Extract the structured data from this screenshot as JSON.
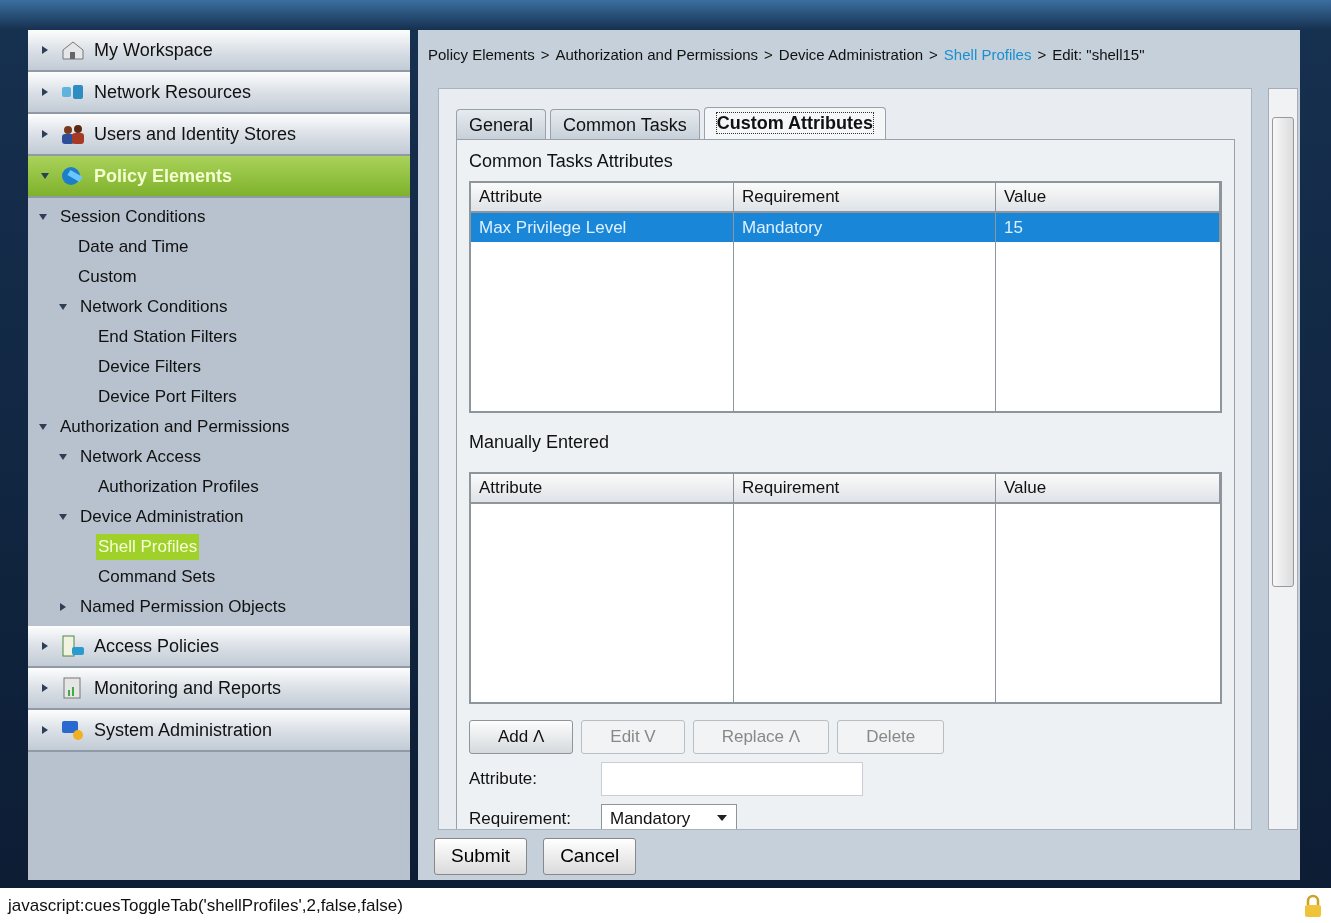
{
  "sidebar": {
    "sections": [
      {
        "label": "My Workspace",
        "expanded": false,
        "selected": false
      },
      {
        "label": "Network Resources",
        "expanded": false,
        "selected": false
      },
      {
        "label": "Users and Identity Stores",
        "expanded": false,
        "selected": false
      },
      {
        "label": "Policy Elements",
        "expanded": true,
        "selected": true,
        "children": [
          {
            "label": "Session Conditions",
            "expanded": true,
            "selected": false,
            "children": [
              {
                "label": "Date and Time",
                "selected": false
              },
              {
                "label": "Custom",
                "selected": false
              },
              {
                "label": "Network Conditions",
                "expanded": true,
                "selected": false,
                "children": [
                  {
                    "label": "End Station Filters",
                    "selected": false
                  },
                  {
                    "label": "Device Filters",
                    "selected": false
                  },
                  {
                    "label": "Device Port Filters",
                    "selected": false
                  }
                ]
              }
            ]
          },
          {
            "label": "Authorization and Permissions",
            "expanded": true,
            "selected": false,
            "children": [
              {
                "label": "Network Access",
                "expanded": true,
                "selected": false,
                "children": [
                  {
                    "label": "Authorization Profiles",
                    "selected": false
                  }
                ]
              },
              {
                "label": "Device Administration",
                "expanded": true,
                "selected": false,
                "children": [
                  {
                    "label": "Shell Profiles",
                    "selected": true
                  },
                  {
                    "label": "Command Sets",
                    "selected": false
                  }
                ]
              },
              {
                "label": "Named Permission Objects",
                "expanded": false,
                "selected": false
              }
            ]
          }
        ]
      },
      {
        "label": "Access Policies",
        "expanded": false,
        "selected": false
      },
      {
        "label": "Monitoring and Reports",
        "expanded": false,
        "selected": false
      },
      {
        "label": "System Administration",
        "expanded": false,
        "selected": false
      }
    ]
  },
  "breadcrumb": {
    "separator": ">",
    "items": [
      {
        "label": "Policy Elements",
        "link": false
      },
      {
        "label": "Authorization and Permissions",
        "link": false
      },
      {
        "label": "Device Administration",
        "link": false
      },
      {
        "label": "Shell Profiles",
        "link": true
      },
      {
        "label": "Edit: \"shell15\"",
        "link": false
      }
    ]
  },
  "tabs": [
    {
      "label": "General",
      "selected": false
    },
    {
      "label": "Common Tasks",
      "selected": false
    },
    {
      "label": "Custom Attributes",
      "selected": true
    }
  ],
  "common_tasks": {
    "title": "Common Tasks Attributes",
    "columns": [
      "Attribute",
      "Requirement",
      "Value"
    ],
    "rows": [
      {
        "cells": [
          "Max Privilege Level",
          "Mandatory",
          "15"
        ],
        "selected": true
      }
    ]
  },
  "manually_entered": {
    "title": "Manually Entered",
    "columns": [
      "Attribute",
      "Requirement",
      "Value"
    ]
  },
  "actions": [
    {
      "label": "Add Λ",
      "disabled": false
    },
    {
      "label": "Edit V",
      "disabled": true
    },
    {
      "label": "Replace Λ",
      "disabled": true
    },
    {
      "label": "Delete",
      "disabled": true
    }
  ],
  "form": {
    "attribute_label": "Attribute:",
    "requirement_label": "Requirement:",
    "requirement_value": "Mandatory"
  },
  "footer_buttons": [
    "Submit",
    "Cancel"
  ],
  "status_bar": {
    "text": "javascript:cuesToggleTab('shellProfiles',2,false,false)"
  }
}
